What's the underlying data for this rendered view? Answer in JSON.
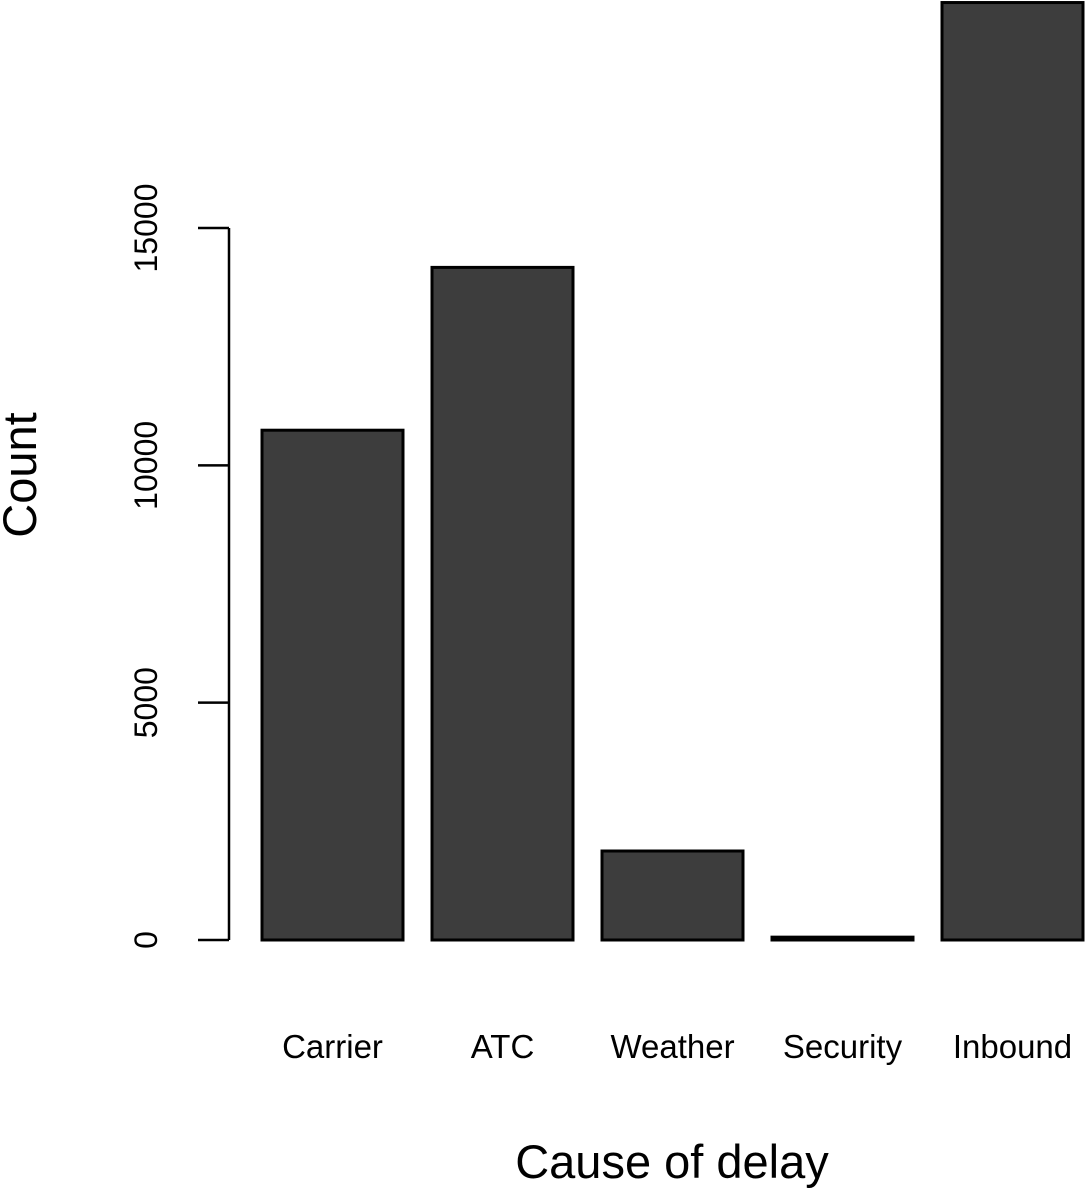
{
  "chart_data": {
    "type": "bar",
    "title": "",
    "xlabel": "Cause of delay",
    "ylabel": "Count",
    "categories": [
      "Carrier",
      "ATC",
      "Weather",
      "Security",
      "Inbound"
    ],
    "values": [
      10740,
      14170,
      1875,
      60,
      19750
    ],
    "ylim": [
      0,
      15000
    ],
    "yticks": [
      0,
      5000,
      10000,
      15000
    ],
    "ytick_labels": [
      "0",
      "5000",
      "10000",
      "15000"
    ],
    "grid": false,
    "legend": "none",
    "bar_color": "#3d3d3d"
  }
}
